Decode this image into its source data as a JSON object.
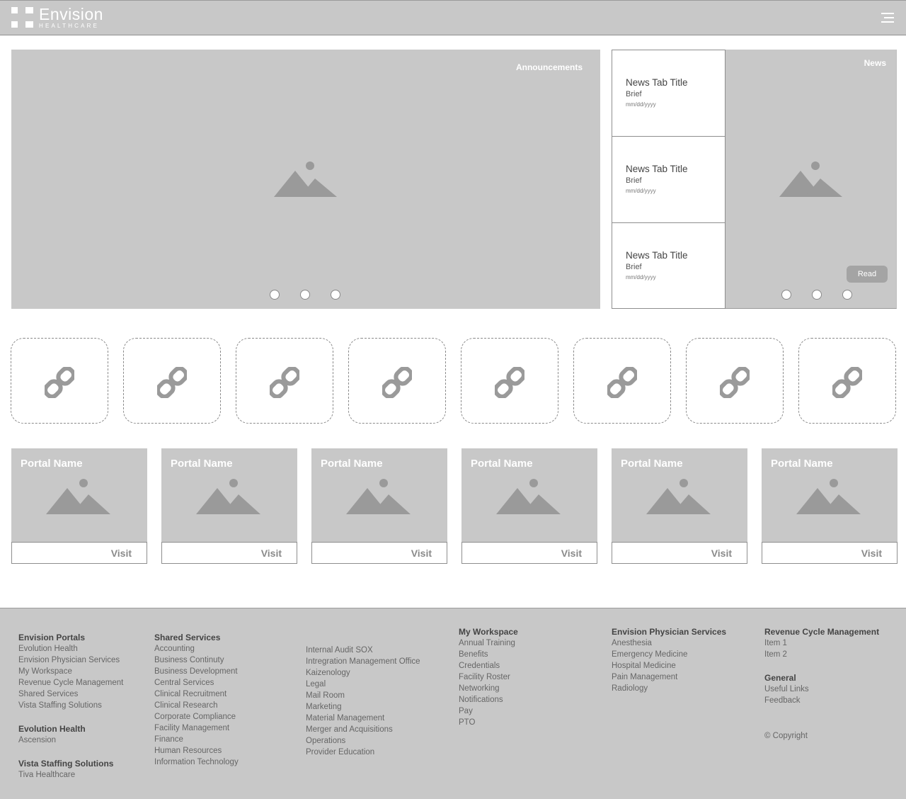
{
  "header": {
    "logo_name": "Envision",
    "logo_sub": "HEALTHCARE",
    "menu_icon": "hamburger-icon"
  },
  "announcements": {
    "title": "Announcements",
    "image_icon": "image-placeholder-icon",
    "carousel_dots": 3
  },
  "news": {
    "title": "News",
    "tabs": [
      {
        "title": "News Tab Title",
        "brief": "Brief",
        "date": "mm/dd/yyyy"
      },
      {
        "title": "News Tab Title",
        "brief": "Brief",
        "date": "mm/dd/yyyy"
      },
      {
        "title": "News Tab Title",
        "brief": "Brief",
        "date": "mm/dd/yyyy"
      }
    ],
    "read_label": "Read",
    "carousel_dots": 3
  },
  "quick_links": {
    "count": 8,
    "icon": "link-icon"
  },
  "portals": [
    {
      "name": "Portal Name",
      "visit": "Visit"
    },
    {
      "name": "Portal Name",
      "visit": "Visit"
    },
    {
      "name": "Portal Name",
      "visit": "Visit"
    },
    {
      "name": "Portal Name",
      "visit": "Visit"
    },
    {
      "name": "Portal Name",
      "visit": "Visit"
    },
    {
      "name": "Portal Name",
      "visit": "Visit"
    }
  ],
  "footer": {
    "col1": {
      "groups": [
        {
          "heading": "Envision Portals",
          "items": [
            "Evolution Health",
            "Envision Physician Services",
            "My Workspace",
            "Revenue Cycle Management",
            "Shared Services",
            "Vista Staffing Solutions"
          ]
        },
        {
          "heading": "Evolution Health",
          "items": [
            "Ascension"
          ]
        },
        {
          "heading": "Vista Staffing Solutions",
          "items": [
            "Tiva Healthcare"
          ]
        }
      ]
    },
    "col2": {
      "heading": "Shared Services",
      "items": [
        "Accounting",
        "Business Continuty",
        "Business Development",
        "Central Services",
        "Clinical Recruitment",
        "Clinical Research",
        "Corporate Compliance",
        "Facility Management",
        "Finance",
        "Human Resources",
        "Information Technology"
      ]
    },
    "col3": {
      "items": [
        "Internal Audit SOX",
        "Intregration Management Office",
        "Kaizenology",
        "Legal",
        "Mail Room",
        "Marketing",
        "Material Management",
        "Merger and Acquisitions",
        "Operations",
        "Provider Education"
      ]
    },
    "col4": {
      "heading": "My Workspace",
      "items": [
        "Annual Training",
        "Benefits",
        "Credentials",
        "Facility Roster",
        "Networking",
        "Notifications",
        "Pay",
        "PTO"
      ]
    },
    "col5": {
      "heading": "Envision Physician Services",
      "items": [
        "Anesthesia",
        "Emergency Medicine",
        "Hospital Medicine",
        "Pain Management",
        "Radiology"
      ]
    },
    "col6": {
      "groups": [
        {
          "heading": "Revenue Cycle Management",
          "items": [
            "Item 1",
            "Item 2"
          ]
        },
        {
          "heading": "General",
          "items": [
            "Useful Links",
            "Feedback"
          ]
        }
      ],
      "copyright": "© Copyright"
    }
  }
}
